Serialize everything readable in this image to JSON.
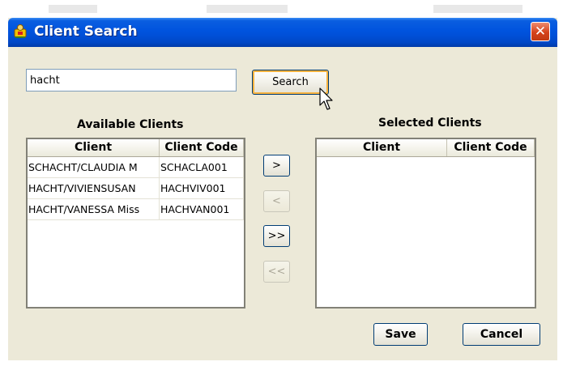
{
  "window": {
    "title": "Client Search"
  },
  "search": {
    "value": "hacht",
    "button_label": "Search"
  },
  "available": {
    "label": "Available Clients",
    "columns": [
      "Client",
      "Client Code"
    ],
    "rows": [
      [
        "SCHACHT/CLAUDIA M",
        "SCHACLA001"
      ],
      [
        "HACHT/VIVIENSUSAN",
        "HACHVIV001"
      ],
      [
        "HACHT/VANESSA Miss",
        "HACHVAN001"
      ]
    ]
  },
  "selected": {
    "label": "Selected Clients",
    "columns": [
      "Client",
      "Client Code"
    ],
    "rows": []
  },
  "transfer": {
    "add_one": ">",
    "remove_one": "<",
    "add_all": ">>",
    "remove_all": "<<"
  },
  "footer": {
    "save_label": "Save",
    "cancel_label": "Cancel"
  },
  "icons": {
    "title": "client-search-icon",
    "close": "close-icon",
    "cursor": "mouse-pointer-icon"
  },
  "colors": {
    "titlebar": "#0053de",
    "close_button": "#d5411a",
    "dialog_bg": "#ECE9D8"
  }
}
